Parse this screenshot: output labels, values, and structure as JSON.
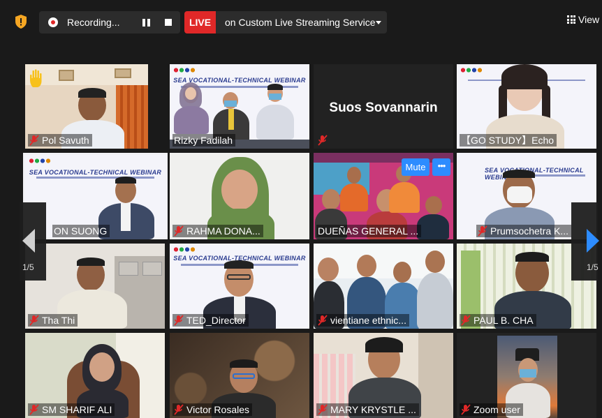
{
  "toolbar": {
    "recording_label": "Recording...",
    "live_label": "LIVE",
    "live_service": "on Custom Live Streaming Service",
    "view_label": "View"
  },
  "navigation": {
    "page_left": "1/5",
    "page_right": "1/5"
  },
  "tile_controls": {
    "mute_label": "Mute",
    "more_label": "•••"
  },
  "colors": {
    "live_red": "#e02828",
    "zoom_blue": "#2d8cff",
    "active_speaker": "#c9e04a",
    "muted_mic": "#e02828"
  },
  "participants": [
    {
      "name": "Pol Savuth",
      "muted": true,
      "raised_hand": true
    },
    {
      "name": "Rizky Fadilah",
      "muted": false
    },
    {
      "name": "Suos Sovannarin",
      "muted": true,
      "video_off": true
    },
    {
      "name": "【GO STUDY】Echo",
      "muted": false
    },
    {
      "name": "ON SUONG",
      "muted": false,
      "active_speaker": true
    },
    {
      "name": "RAHMA DONA...",
      "muted": true
    },
    {
      "name": "DUEÑAS GENERAL ...",
      "muted": false
    },
    {
      "name": "Prumsochetra K...",
      "muted": true
    },
    {
      "name": "Tha Thi",
      "muted": true
    },
    {
      "name": "TED_Director",
      "muted": true
    },
    {
      "name": "vientiane ethnic...",
      "muted": true
    },
    {
      "name": "PAUL B. CHA",
      "muted": true
    },
    {
      "name": "SM SHARIF ALI",
      "muted": true
    },
    {
      "name": "Victor Rosales",
      "muted": true
    },
    {
      "name": "MARY KRYSTLE ...",
      "muted": true
    },
    {
      "name": "Zoom user",
      "muted": true
    }
  ]
}
